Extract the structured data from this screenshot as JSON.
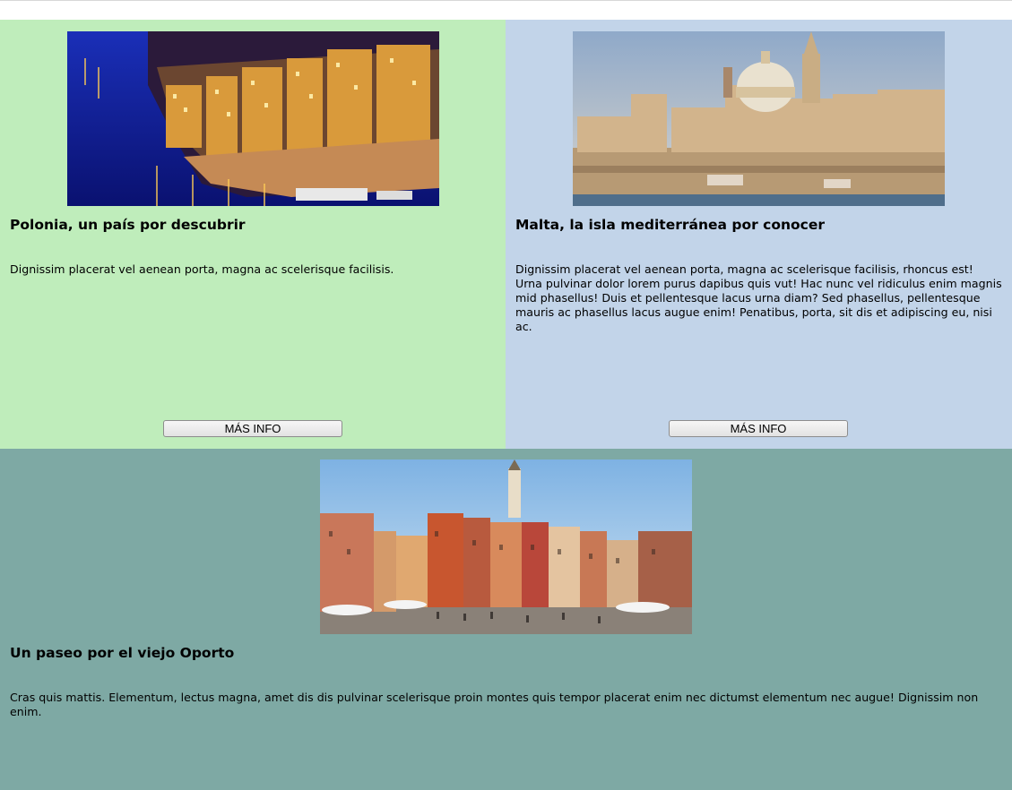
{
  "cards": [
    {
      "title": "Polonia, un país por descubrir",
      "text": "Dignissim placerat vel aenean porta, magna ac scelerisque facilisis.",
      "button": "MÁS INFO",
      "bg": "#bfedbb",
      "photo": "porto-river-night-photo"
    },
    {
      "title": "Malta, la isla mediterránea por conocer",
      "text": "Dignissim placerat vel aenean porta, magna ac scelerisque facilisis, rhoncus est! Urna pulvinar dolor lorem purus dapibus quis vut! Hac nunc vel ridiculus enim magnis mid phasellus! Duis et pellentesque lacus urna diam? Sed phasellus, pellentesque mauris ac phasellus lacus augue enim! Penatibus, porta, sit dis et adipiscing eu, nisi ac.",
      "button": "MÁS INFO",
      "bg": "#c2d4e9",
      "photo": "valletta-skyline-photo"
    },
    {
      "title": "Un paseo por el viejo Oporto",
      "text": "Cras quis mattis. Elementum, lectus magna, amet dis dis pulvinar scelerisque proin montes quis tempor placerat enim nec dictumst elementum nec augue! Dignissim non enim.",
      "bg": "#7ea9a4",
      "photo": "warsaw-old-town-square-photo"
    }
  ]
}
